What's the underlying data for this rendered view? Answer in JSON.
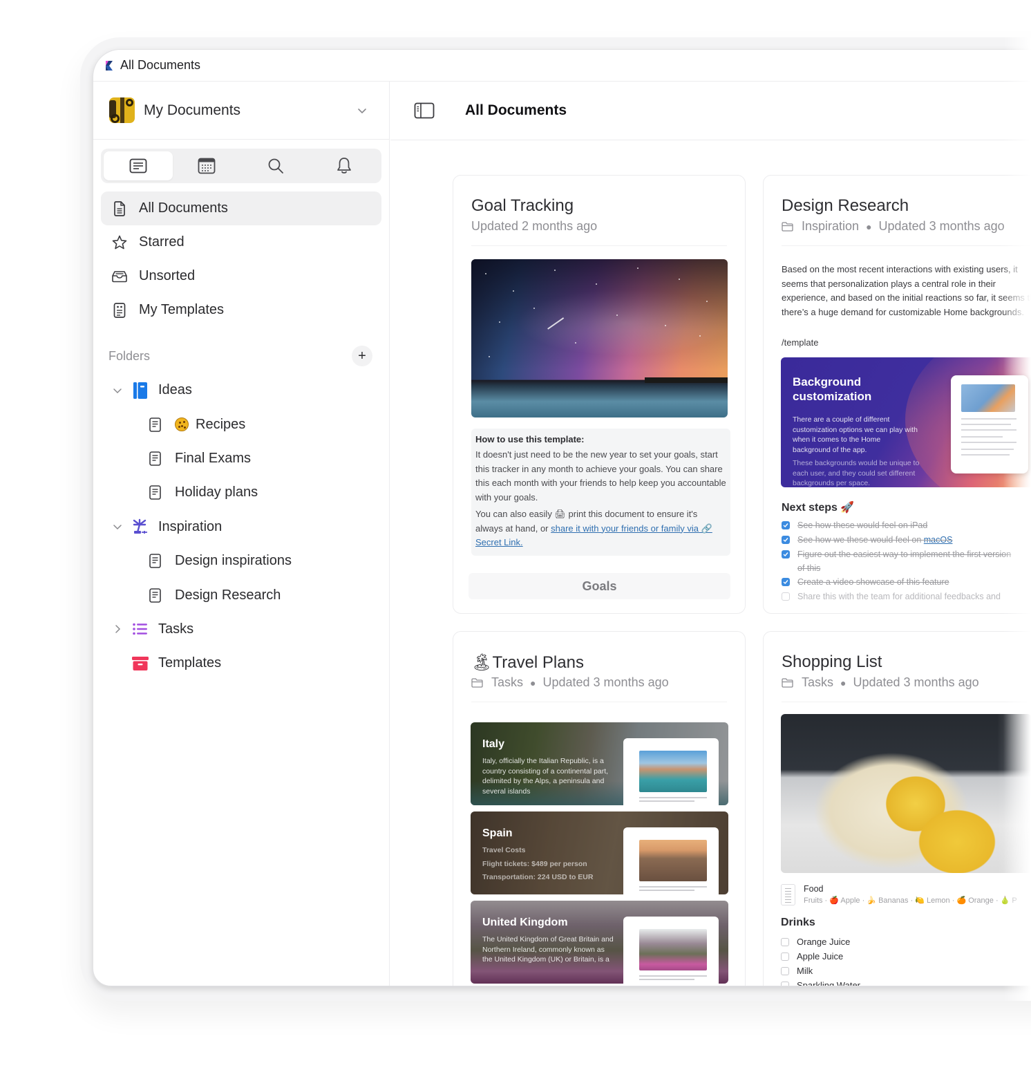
{
  "window": {
    "title": "All Documents"
  },
  "workspace": {
    "name": "My Documents"
  },
  "sidebar_tabs": [
    {
      "name": "documents",
      "icon": "document-lines-icon",
      "active": true
    },
    {
      "name": "calendar",
      "icon": "calendar-icon",
      "active": false
    },
    {
      "name": "search",
      "icon": "search-icon",
      "active": false
    },
    {
      "name": "notifications",
      "icon": "bell-icon",
      "active": false
    }
  ],
  "nav": [
    {
      "label": "All Documents",
      "icon": "document-icon",
      "active": true
    },
    {
      "label": "Starred",
      "icon": "star-icon",
      "active": false
    },
    {
      "label": "Unsorted",
      "icon": "inbox-tray-icon",
      "active": false
    },
    {
      "label": "My Templates",
      "icon": "template-icon",
      "active": false
    }
  ],
  "folders": {
    "title": "Folders",
    "add_label": "+",
    "tree": [
      {
        "type": "folder",
        "label": "Ideas",
        "icon": "notebook-icon",
        "expanded": true,
        "color": "#1a7ae8"
      },
      {
        "type": "doc",
        "label": "Recipes",
        "emoji": "cookie"
      },
      {
        "type": "doc",
        "label": "Final Exams"
      },
      {
        "type": "doc",
        "label": "Holiday plans"
      },
      {
        "type": "folder",
        "label": "Inspiration",
        "icon": "palm-island-icon",
        "expanded": true,
        "color": "#5a4fd0"
      },
      {
        "type": "doc",
        "label": "Design inspirations"
      },
      {
        "type": "doc",
        "label": "Design Research"
      },
      {
        "type": "folder",
        "label": "Tasks",
        "icon": "list-icon",
        "expanded": false,
        "color": "#a24ee0"
      },
      {
        "type": "folder",
        "label": "Templates",
        "icon": "archive-box-icon",
        "expanded": null,
        "color": "#f0365a"
      }
    ]
  },
  "main": {
    "title": "All Documents"
  },
  "cards": {
    "goal_tracking": {
      "title": "Goal Tracking",
      "meta": "Updated 2 months ago",
      "howto_heading": "How to use this template:",
      "howto_p1": "It doesn't just need to be the new year to set your goals, start this tracker in any month to achieve your goals. You can share this each month with your friends to help keep you accountable with your goals.",
      "howto_p2_pre": "You can also easily 🖨 print this document to ensure it's always at hand, or ",
      "howto_p2_link": "share it with your friends or family via 🔗 Secret Link.",
      "tab_label": "Goals"
    },
    "design_research": {
      "title": "Design Research",
      "folder": "Inspiration",
      "meta": "Updated 3 months ago",
      "body": "Based on the most recent interactions with existing users, it seems that personalization plays a central role in their experience, and based on the initial reactions so far, it seems that there’s a huge demand for customizable Home backgrounds.",
      "slash": "/template",
      "embed_title": "Background customization",
      "embed_p1": "There are a couple of different customization options we can play with when it comes to the Home background of the app.",
      "embed_p2": "These backgrounds would be unique to each user, and they could set different backgrounds per space.",
      "next_steps_title": "Next steps 🚀",
      "tasks": [
        {
          "text": "See how these would feel on iPad",
          "done": true
        },
        {
          "text": "See how we these would feel on ",
          "link": "macOS",
          "done": true
        },
        {
          "text": "Figure out the easiest way to implement the first version",
          "text2": "of this",
          "done": true
        },
        {
          "text": "Create a video showcase of this feature",
          "done": true
        },
        {
          "text": "Share this with the team for additional feedbacks and",
          "done": false
        }
      ]
    },
    "travel_plans": {
      "emoji": "🏝",
      "title": "Travel Plans",
      "folder": "Tasks",
      "meta": "Updated 3 months ago",
      "strips": [
        {
          "title": "Italy",
          "text": "Italy, officially the Italian Republic, is a country consisting of a continental part, delimited by the Alps, a peninsula and several islands"
        },
        {
          "title": "Spain",
          "text": "Travel Costs\nFlight tickets: $489 per person\nTransportation: 224 USD to EUR"
        },
        {
          "title": "United Kingdom",
          "text": "The United Kingdom of Great Britain and Northern Ireland, commonly known as the United Kingdom (UK) or Britain, is a"
        }
      ]
    },
    "shopping_list": {
      "title": "Shopping List",
      "folder": "Tasks",
      "meta": "Updated 3 months ago",
      "food_title": "Food",
      "food_sub": "Fruits · 🍎 Apple · 🍌 Bananas · 🍋 Lemon · 🍊 Orange · 🍐 P",
      "drinks_title": "Drinks",
      "drinks": [
        {
          "label": "Orange Juice",
          "checked": false
        },
        {
          "label": "Apple Juice",
          "checked": false
        },
        {
          "label": "Milk",
          "checked": false
        },
        {
          "label": "Sparkling Water",
          "checked": false
        }
      ]
    }
  }
}
